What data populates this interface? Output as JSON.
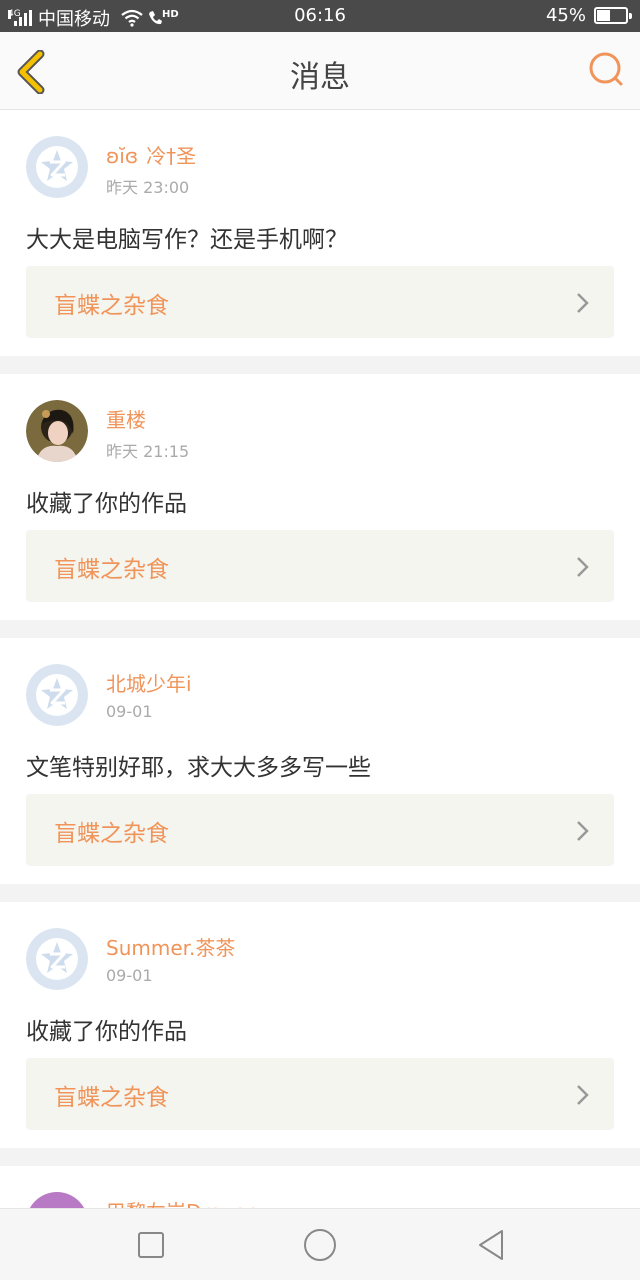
{
  "statusbar": {
    "network": "4G",
    "carrier": "中国移动",
    "hd": "HD",
    "time": "06:16",
    "battery_text": "45%",
    "battery_level": 0.45,
    "icons": [
      "signal-icon",
      "wifi-icon",
      "call-hd-icon",
      "battery-icon"
    ]
  },
  "header": {
    "title": "消息",
    "back_icon": "chevron-left-icon",
    "search_icon": "search-icon",
    "accent": "#f0945a",
    "back_color": "#f5c000"
  },
  "messages": [
    {
      "name": "冷†圣",
      "name_prefix": "ʚĭɞ",
      "time": "昨天 23:00",
      "text": "大大是电脑写作？还是手机啊？",
      "link": "盲蝶之杂食",
      "avatar": "qzone-default-icon"
    },
    {
      "name": "重楼",
      "time": "昨天 21:15",
      "text": "收藏了你的作品",
      "link": "盲蝶之杂食",
      "avatar": "user-photo"
    },
    {
      "name": "北城少年i",
      "time": "09-01",
      "text": "文笔特别好耶，求大大多多写一些",
      "link": "盲蝶之杂食",
      "avatar": "qzone-default-icon"
    },
    {
      "name": "Summer.茶茶",
      "time": "09-01",
      "text": "收藏了你的作品",
      "link": "盲蝶之杂食",
      "avatar": "qzone-default-icon"
    },
    {
      "name": "巴黎左岸Draven",
      "time": "",
      "text": "",
      "link": "",
      "avatar": "user-photo",
      "partial": true
    }
  ],
  "bottom_nav": [
    "square-icon",
    "circle-icon",
    "triangle-back-icon"
  ]
}
